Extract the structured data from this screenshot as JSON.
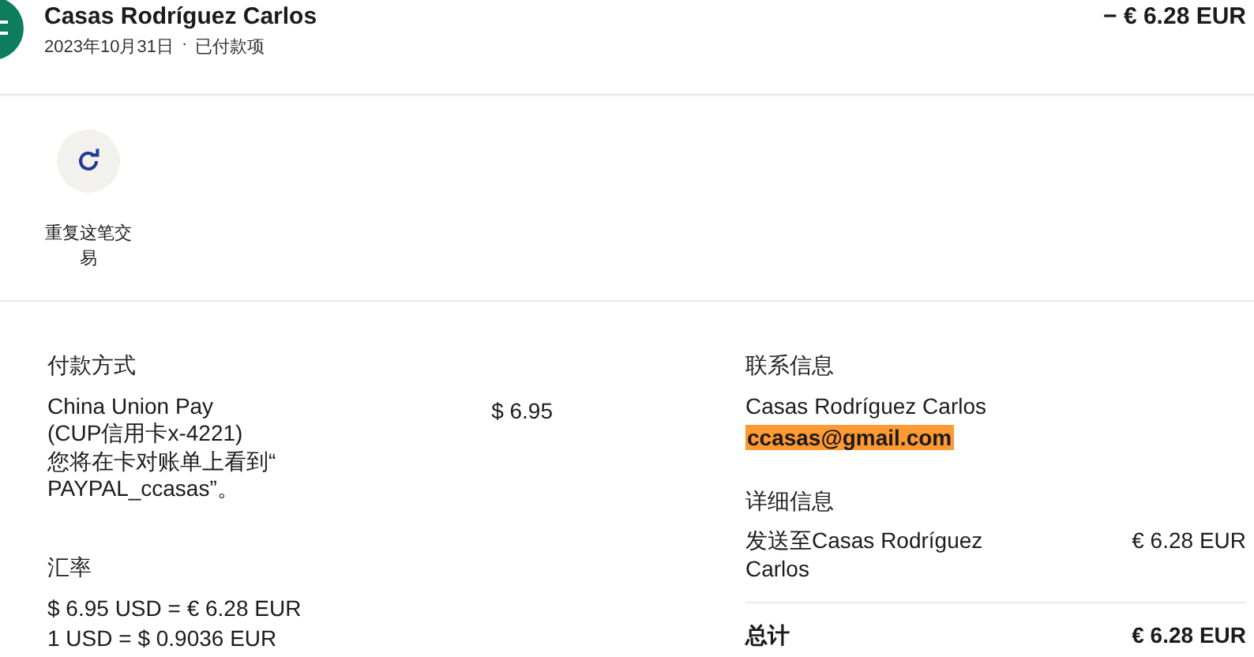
{
  "header": {
    "name": "Casas Rodríguez Carlos",
    "date": "2023年10月31日",
    "separator": "·",
    "status": "已付款项",
    "amount": "− € 6.28 EUR"
  },
  "actions": [
    {
      "label": "重复这笔交易"
    }
  ],
  "payment": {
    "heading": "付款方式",
    "method": "China Union Pay (CUP信用卡x-4221)",
    "note": "您将在卡对账单上看到“PAYPAL_ccasas”。",
    "amount": "$ 6.95"
  },
  "exchange": {
    "heading": "汇率",
    "lines": [
      "$ 6.95 USD = € 6.28 EUR",
      "1 USD = $ 0.9036 EUR"
    ]
  },
  "contact": {
    "heading": "联系信息",
    "name": "Casas Rodríguez Carlos",
    "email": "ccasas@gmail.com",
    "email_highlighted": true
  },
  "details": {
    "heading": "详细信息",
    "items": [
      {
        "label": "发送至Casas Rodríguez Carlos",
        "amount": "€ 6.28 EUR"
      }
    ],
    "total_label": "总计",
    "total_amount": "€ 6.28 EUR"
  }
}
